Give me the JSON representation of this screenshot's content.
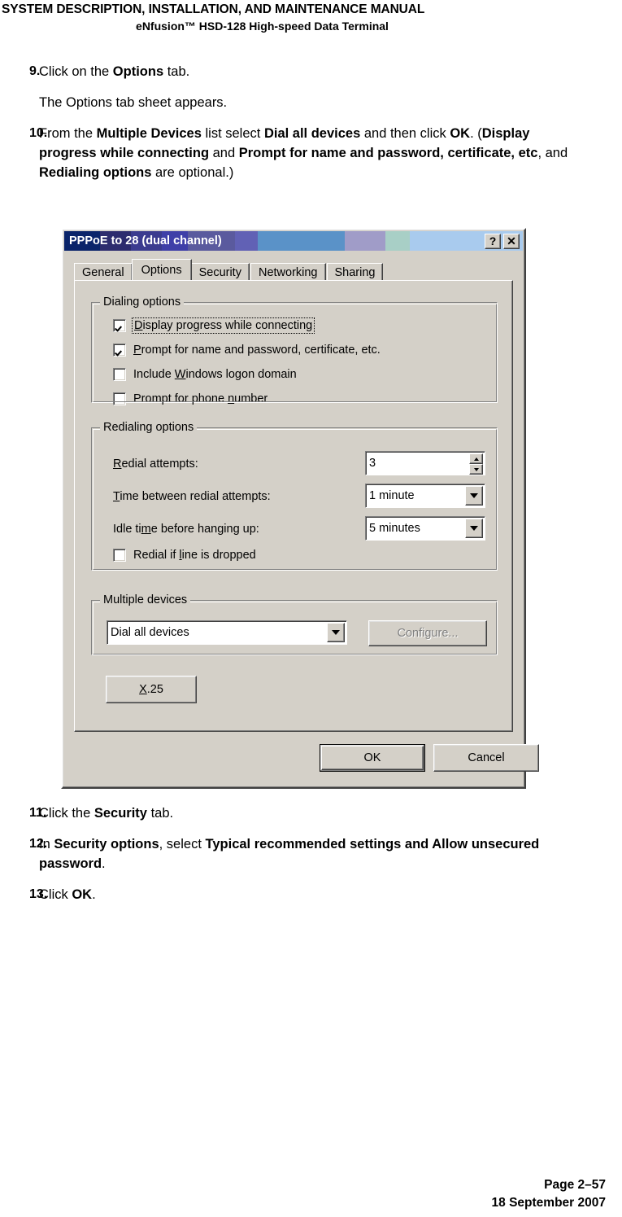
{
  "header": {
    "line1": "SYSTEM DESCRIPTION, INSTALLATION, AND MAINTENANCE MANUAL",
    "line2": "eNfusion™ HSD-128 High-speed Data Terminal"
  },
  "steps_top": [
    {
      "num": "9.",
      "segments": [
        {
          "t": "Click on the ",
          "b": false
        },
        {
          "t": "Options",
          "b": true
        },
        {
          "t": " tab.",
          "b": false
        }
      ]
    },
    {
      "num": "",
      "segments": [
        {
          "t": "The Options tab sheet appears.",
          "b": false
        }
      ]
    },
    {
      "num": "10.",
      "segments": [
        {
          "t": "From the ",
          "b": false
        },
        {
          "t": "Multiple Devices",
          "b": true
        },
        {
          "t": " list select ",
          "b": false
        },
        {
          "t": "Dial all devices",
          "b": true
        },
        {
          "t": " and then click ",
          "b": false
        },
        {
          "t": "OK",
          "b": true
        },
        {
          "t": ". (",
          "b": false
        },
        {
          "t": "Display progress while connecting",
          "b": true
        },
        {
          "t": " and ",
          "b": false
        },
        {
          "t": "Prompt for name and password, certificate, etc",
          "b": true
        },
        {
          "t": ", and ",
          "b": false
        },
        {
          "t": "Redialing options",
          "b": true
        },
        {
          "t": " are optional.)",
          "b": false
        }
      ]
    }
  ],
  "steps_bottom": [
    {
      "num": "11.",
      "segments": [
        {
          "t": "Click the ",
          "b": false
        },
        {
          "t": "Security",
          "b": true
        },
        {
          "t": " tab.",
          "b": false
        }
      ]
    },
    {
      "num": "12.",
      "segments": [
        {
          "t": "In ",
          "b": false
        },
        {
          "t": "Security options",
          "b": true
        },
        {
          "t": ", select ",
          "b": false
        },
        {
          "t": "Typical recommended settings and Allow unsecured password",
          "b": true
        },
        {
          "t": ".",
          "b": false
        }
      ]
    },
    {
      "num": "13.",
      "segments": [
        {
          "t": "Click ",
          "b": false
        },
        {
          "t": "OK",
          "b": true
        },
        {
          "t": ".",
          "b": false
        }
      ]
    }
  ],
  "dialog": {
    "title": "PPPoE to 28 (dual channel)",
    "help_button": "?",
    "close_button": "✕",
    "tabs": [
      {
        "label": "General",
        "active": false
      },
      {
        "label": "Options",
        "active": true
      },
      {
        "label": "Security",
        "active": false
      },
      {
        "label": "Networking",
        "active": false
      },
      {
        "label": "Sharing",
        "active": false
      }
    ],
    "dialing_options": {
      "title": "Dialing options",
      "items": [
        {
          "label": "Display progress while connecting",
          "checked": true,
          "focused": true,
          "accel_index": 0
        },
        {
          "label": "Prompt for name and password, certificate, etc.",
          "checked": true,
          "focused": false,
          "accel_index": 0
        },
        {
          "label": "Include Windows logon domain",
          "checked": false,
          "focused": false,
          "accel_index": 8
        },
        {
          "label": "Prompt for phone number",
          "checked": false,
          "focused": false,
          "accel_index": 17
        }
      ]
    },
    "redialing_options": {
      "title": "Redialing options",
      "redial_attempts_label": "Redial attempts:",
      "redial_attempts_value": "3",
      "time_between_label": "Time between redial attempts:",
      "time_between_value": "1 minute",
      "idle_time_label": "Idle time before hanging up:",
      "idle_time_value": "5 minutes",
      "redial_if_dropped_label": "Redial if line is dropped",
      "redial_if_dropped_checked": false
    },
    "multiple_devices": {
      "title": "Multiple devices",
      "selected": "Dial all devices",
      "configure_label": "Configure...",
      "configure_disabled": true
    },
    "x25_label": "X.25",
    "ok_label": "OK",
    "cancel_label": "Cancel"
  },
  "footer": {
    "page": "Page 2–57",
    "date": "18 September 2007"
  }
}
